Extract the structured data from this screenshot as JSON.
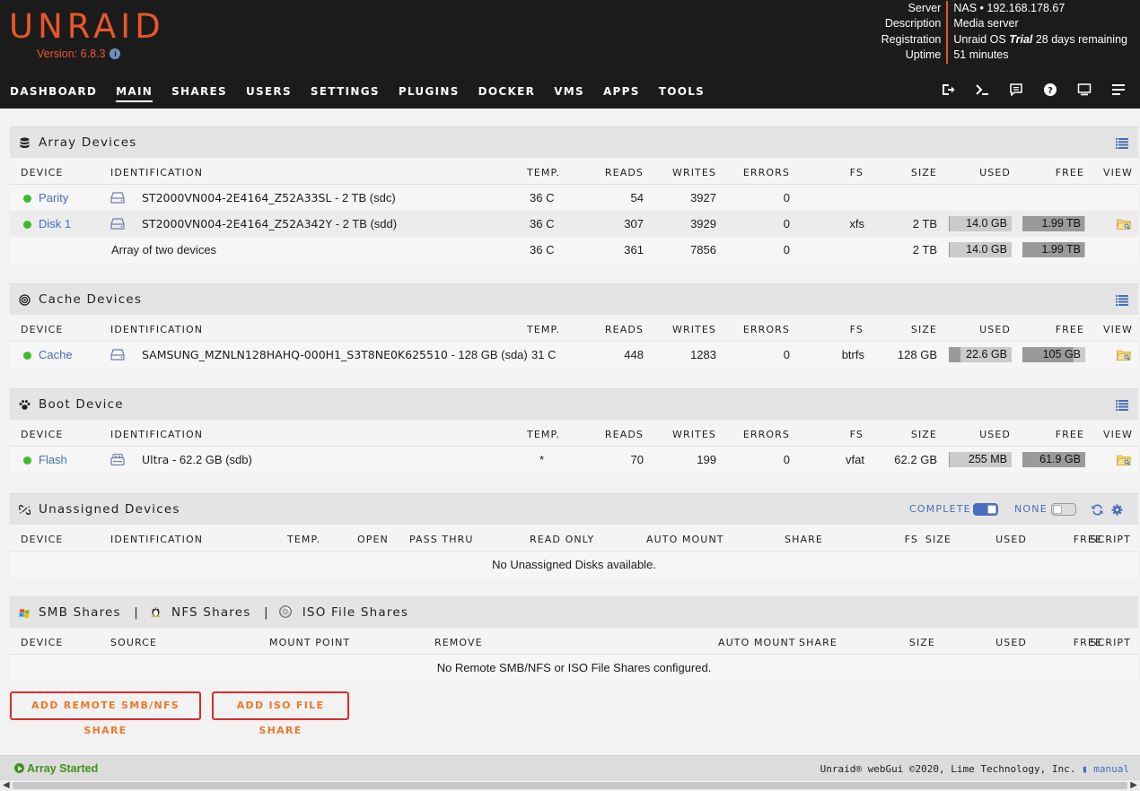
{
  "header": {
    "logo": "UNRAID",
    "version": "Version: 6.8.3",
    "server_info": [
      {
        "label": "Server",
        "value": "NAS • 192.168.178.67"
      },
      {
        "label": "Description",
        "value": "Media server"
      },
      {
        "label": "Registration",
        "value_pre": "Unraid OS ",
        "value_em": "Trial",
        "value_post": " 28 days remaining"
      },
      {
        "label": "Uptime",
        "value": "51 minutes"
      }
    ],
    "nav": [
      "DASHBOARD",
      "MAIN",
      "SHARES",
      "USERS",
      "SETTINGS",
      "PLUGINS",
      "DOCKER",
      "VMS",
      "APPS",
      "TOOLS"
    ],
    "active_nav": "MAIN",
    "icons": [
      "logout-icon",
      "terminal-icon",
      "log-icon",
      "help-icon",
      "monitor-icon",
      "menu-icon"
    ]
  },
  "array": {
    "title": "Array Devices",
    "headers": [
      "DEVICE",
      "IDENTIFICATION",
      "TEMP.",
      "READS",
      "WRITES",
      "ERRORS",
      "FS",
      "SIZE",
      "USED",
      "FREE",
      "VIEW"
    ],
    "rows": [
      {
        "device": "Parity",
        "id": "ST2000VN004-2E4164_Z52A33SL",
        "id_suffix": " - 2 TB (sdc)",
        "temp": "36 C",
        "reads": "54",
        "writes": "3927",
        "errors": "0",
        "fs": "",
        "size": "",
        "used": "",
        "free": ""
      },
      {
        "device": "Disk 1",
        "id": "ST2000VN004-2E4164_Z52A342Y",
        "id_suffix": " - 2 TB (sdd)",
        "temp": "36 C",
        "reads": "307",
        "writes": "3929",
        "errors": "0",
        "fs": "xfs",
        "size": "2 TB",
        "used": "14.0 GB",
        "free": "1.99 TB",
        "used_frac": 0.01,
        "free_frac": 0.99
      }
    ],
    "summary": {
      "label": "Array of two devices",
      "temp": "36 C",
      "reads": "361",
      "writes": "7856",
      "errors": "0",
      "size": "2 TB",
      "used": "14.0 GB",
      "free": "1.99 TB",
      "used_frac": 0.01,
      "free_frac": 0.99
    }
  },
  "cache": {
    "title": "Cache Devices",
    "headers": [
      "DEVICE",
      "IDENTIFICATION",
      "TEMP.",
      "READS",
      "WRITES",
      "ERRORS",
      "FS",
      "SIZE",
      "USED",
      "FREE",
      "VIEW"
    ],
    "row": {
      "device": "Cache",
      "id": "SAMSUNG_MZNLN128HAHQ-000H1_S3T8NE0K625510",
      "id_suffix": " - 128 GB (sda)",
      "temp": "31 C",
      "reads": "448",
      "writes": "1283",
      "errors": "0",
      "fs": "btrfs",
      "size": "128 GB",
      "used": "22.6 GB",
      "free": "105 GB",
      "used_frac": 0.18,
      "free_frac": 0.82
    }
  },
  "boot": {
    "title": "Boot Device",
    "headers": [
      "DEVICE",
      "IDENTIFICATION",
      "TEMP.",
      "READS",
      "WRITES",
      "ERRORS",
      "FS",
      "SIZE",
      "USED",
      "FREE",
      "VIEW"
    ],
    "row": {
      "device": "Flash",
      "id": "Ultra",
      "id_suffix": " - 62.2 GB (sdb)",
      "temp": "*",
      "reads": "70",
      "writes": "199",
      "errors": "0",
      "fs": "vfat",
      "size": "62.2 GB",
      "used": "255 MB",
      "free": "61.9 GB",
      "used_frac": 0.004,
      "free_frac": 0.996
    }
  },
  "unassigned": {
    "title": "Unassigned Devices",
    "toggle_complete": "COMPLETE",
    "toggle_none": "NONE",
    "headers": [
      "DEVICE",
      "IDENTIFICATION",
      "TEMP.",
      "OPEN",
      "PASS THRU",
      "READ ONLY",
      "AUTO MOUNT",
      "SHARE",
      "FS",
      "SIZE",
      "USED",
      "FREE",
      "SCRIPT"
    ],
    "empty": "No Unassigned Disks available."
  },
  "remote": {
    "title_smb": "SMB Shares",
    "sep1": "|",
    "title_nfs": "NFS Shares",
    "sep2": "|",
    "title_iso": "ISO File Shares",
    "headers": [
      "DEVICE",
      "SOURCE",
      "MOUNT POINT",
      "REMOVE",
      "AUTO MOUNT",
      "SHARE",
      "SIZE",
      "USED",
      "FREE",
      "SCRIPT"
    ],
    "empty": "No Remote SMB/NFS or ISO File Shares configured.",
    "btn_smb": "ADD REMOTE SMB/NFS SHARE",
    "btn_iso": "ADD ISO FILE SHARE"
  },
  "footer": {
    "status": "Array Started",
    "copyright": "Unraid® webGui ©2020, Lime Technology, Inc.",
    "manual": "manual"
  },
  "colors": {
    "accent": "#e8572a",
    "link": "#486dba",
    "green": "#3cbc2c"
  }
}
